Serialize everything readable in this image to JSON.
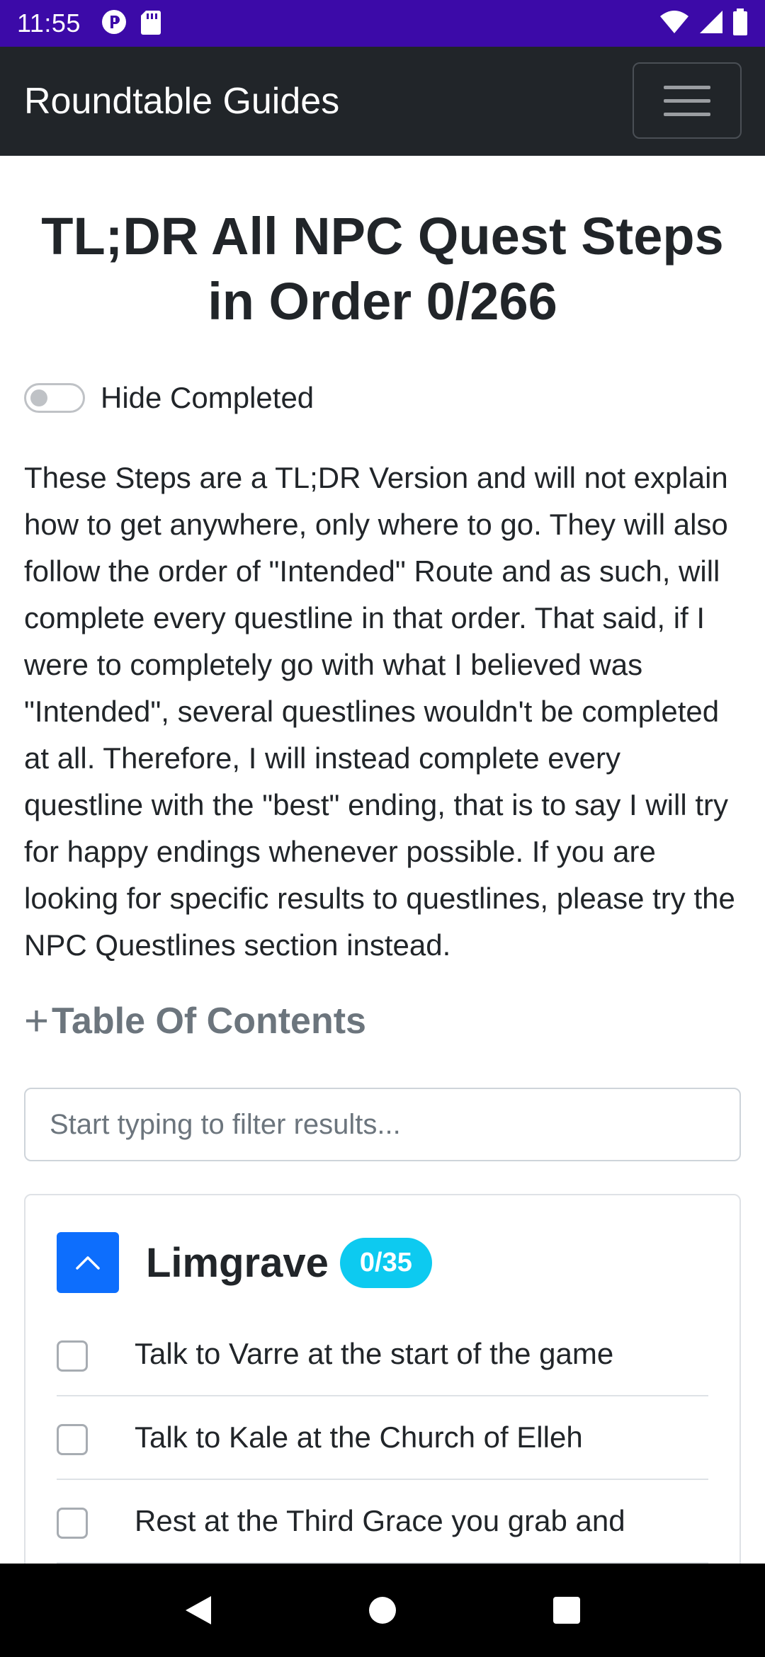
{
  "status_bar": {
    "time": "11:55",
    "icons": [
      "notification-icon",
      "sd-card-icon",
      "wifi-icon",
      "signal-icon",
      "battery-icon"
    ]
  },
  "navbar": {
    "brand": "Roundtable Guides",
    "menu_icon": "hamburger-menu-icon"
  },
  "page": {
    "title": "TL;DR All NPC Quest Steps in Order 0/266",
    "hide_completed_label": "Hide Completed",
    "hide_completed_on": false,
    "intro": "These Steps are a TL;DR Version and will not explain how to get anywhere, only where to go. They will also follow the order of \"Intended\" Route and as such, will complete every questline in that order. That said, if I were to completely go with what I believed was \"Intended\", several questlines wouldn't be completed at all. Therefore, I will instead complete every questline with the \"best\" ending, that is to say I will try for happy endings whenever possible. If you are looking for specific results to questlines, please try the NPC Questlines section instead.",
    "toc_heading": "Table Of Contents",
    "filter_placeholder": "Start typing to filter results...",
    "filter_value": ""
  },
  "section": {
    "title": "Limgrave",
    "badge": "0/35",
    "steps": [
      {
        "text": "Talk to Varre at the start of the game",
        "checked": false
      },
      {
        "text": "Talk to Kale at the Church of Elleh",
        "checked": false
      },
      {
        "text": "Rest at the Third Grace you grab and",
        "checked": false
      }
    ]
  },
  "colors": {
    "status_bar": "#3c0aa8",
    "navbar": "#212529",
    "primary": "#0d6efd",
    "badge": "#0dcaf0",
    "muted": "#6c757d"
  }
}
